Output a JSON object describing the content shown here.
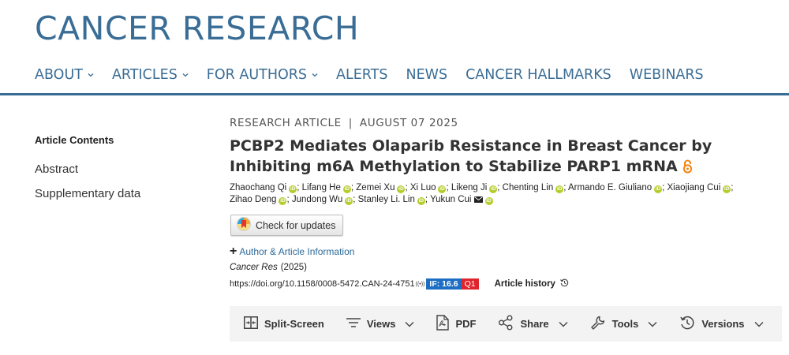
{
  "site": {
    "title": "CANCER RESEARCH"
  },
  "nav": {
    "items": [
      {
        "label": "ABOUT",
        "dropdown": true
      },
      {
        "label": "ARTICLES",
        "dropdown": true
      },
      {
        "label": "FOR AUTHORS",
        "dropdown": true
      },
      {
        "label": "ALERTS",
        "dropdown": false
      },
      {
        "label": "NEWS",
        "dropdown": false
      },
      {
        "label": "CANCER HALLMARKS",
        "dropdown": false
      },
      {
        "label": "WEBINARS",
        "dropdown": false
      }
    ]
  },
  "sidebar": {
    "heading": "Article Contents",
    "items": [
      {
        "label": "Abstract"
      },
      {
        "label": "Supplementary data"
      }
    ]
  },
  "article": {
    "type": "RESEARCH ARTICLE",
    "separator": "|",
    "date": "AUGUST 07 2025",
    "title": "PCBP2 Mediates Olaparib Resistance in Breast Cancer by Inhibiting m6A Methylation to Stabilize PARP1 mRNA",
    "authors": [
      "Zhaochang Qi",
      "Lifang He",
      "Zemei Xu",
      "Xi Luo",
      "Likeng Ji",
      "Chenting Lin",
      "Armando E. Giuliano",
      "Xiaojiang Cui",
      "Zihao Deng",
      "Jundong Wu",
      "Stanley Li. Lin",
      "Yukun Cui"
    ],
    "check_updates_label": "Check for updates",
    "author_info_label": "Author & Article Information",
    "journal": "Cancer Res",
    "year": "(2025)",
    "doi": "https://doi.org/10.1158/0008-5472.CAN-24-4751",
    "impact_factor": "IF: 16.6",
    "quartile": "Q1",
    "history_label": "Article history"
  },
  "toolbar": {
    "split_screen": "Split-Screen",
    "views": "Views",
    "pdf": "PDF",
    "share": "Share",
    "tools": "Tools",
    "versions": "Versions"
  },
  "colors": {
    "brand": "#3a6d95",
    "orcid": "#b5cc2a",
    "open_access": "#f68212",
    "if_badge": "#1e6fc4",
    "q_badge": "#e0242b",
    "link": "#2d6a99"
  }
}
